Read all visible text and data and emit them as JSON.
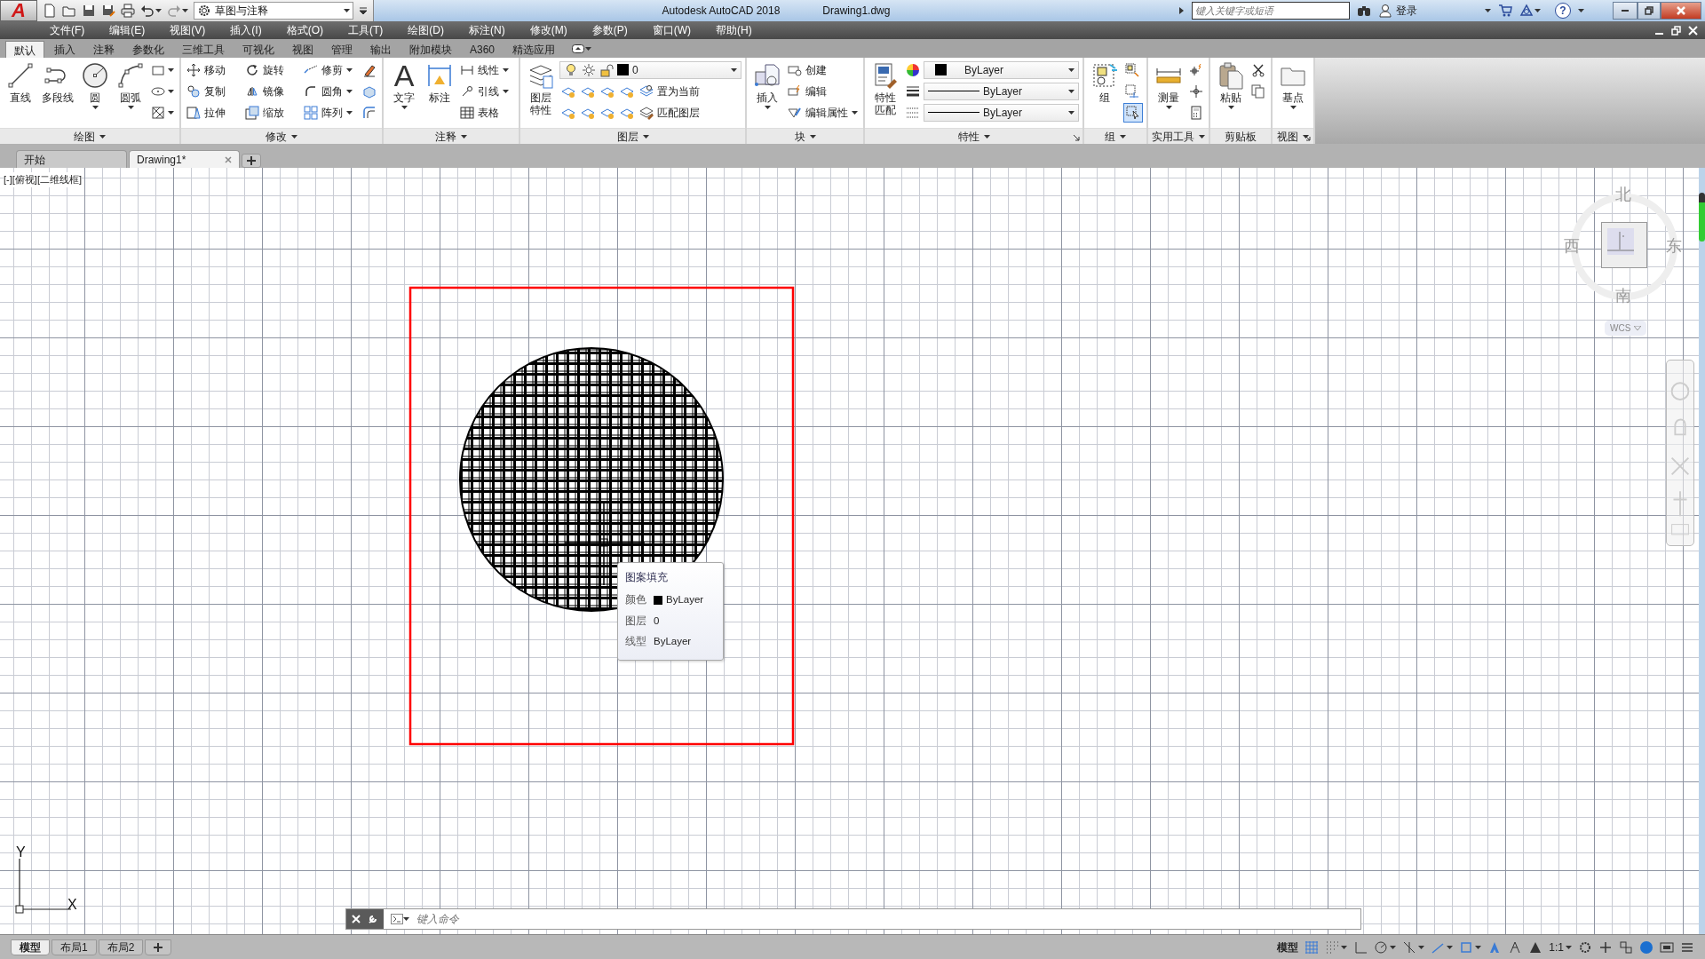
{
  "app_button": "A",
  "quick_access": {
    "workspace": "草图与注释"
  },
  "title_bar": {
    "title": "Autodesk AutoCAD 2018",
    "document": "Drawing1.dwg",
    "search": {
      "placeholder": "键入关键字或短语"
    },
    "sign_in": "登录",
    "help": "?"
  },
  "menu_bar": [
    "文件(F)",
    "编辑(E)",
    "视图(V)",
    "插入(I)",
    "格式(O)",
    "工具(T)",
    "绘图(D)",
    "标注(N)",
    "修改(M)",
    "参数(P)",
    "窗口(W)",
    "帮助(H)"
  ],
  "ribbon_tabs": [
    {
      "label": "默认",
      "selected": true
    },
    {
      "label": "插入",
      "selected": false
    },
    {
      "label": "注释",
      "selected": false
    },
    {
      "label": "参数化",
      "selected": false
    },
    {
      "label": "三维工具",
      "selected": false
    },
    {
      "label": "可视化",
      "selected": false
    },
    {
      "label": "视图",
      "selected": false
    },
    {
      "label": "管理",
      "selected": false
    },
    {
      "label": "输出",
      "selected": false
    },
    {
      "label": "附加模块",
      "selected": false
    },
    {
      "label": "A360",
      "selected": false
    },
    {
      "label": "精选应用",
      "selected": false
    }
  ],
  "ribbon_panels": [
    {
      "title": "绘图",
      "dropdown": true,
      "launcher": false,
      "large": [
        {
          "label": "直线",
          "dropdown": false
        },
        {
          "label": "多段线",
          "dropdown": false
        },
        {
          "label": "圆",
          "dropdown": true
        },
        {
          "label": "圆弧",
          "dropdown": true
        }
      ],
      "rows": [
        [
          {
            "kind": "icon",
            "dropdown": true
          }
        ],
        [
          {
            "kind": "icon",
            "dropdown": true
          }
        ],
        [
          {
            "kind": "icon",
            "dropdown": true
          }
        ]
      ]
    },
    {
      "title": "修改",
      "dropdown": true,
      "launcher": false,
      "rows": [
        [
          {
            "kind": "small",
            "label": "移动",
            "dropdown": false
          },
          {
            "kind": "small",
            "label": "旋转",
            "dropdown": false
          },
          {
            "kind": "small",
            "label": "修剪",
            "dropdown": true
          },
          {
            "kind": "icon",
            "dropdown": false
          }
        ],
        [
          {
            "kind": "small",
            "label": "复制",
            "dropdown": false
          },
          {
            "kind": "small",
            "label": "镜像",
            "dropdown": false
          },
          {
            "kind": "small",
            "label": "圆角",
            "dropdown": true
          },
          {
            "kind": "icon",
            "dropdown": false
          }
        ],
        [
          {
            "kind": "small",
            "label": "拉伸",
            "dropdown": false
          },
          {
            "kind": "small",
            "label": "缩放",
            "dropdown": false
          },
          {
            "kind": "small",
            "label": "阵列",
            "dropdown": true
          },
          {
            "kind": "icon",
            "dropdown": false
          }
        ]
      ]
    },
    {
      "title": "注释",
      "dropdown": true,
      "launcher": false,
      "large": [
        {
          "label": "文字",
          "glyph": "A",
          "dropdown": true
        },
        {
          "label": "标注",
          "dropdown": false
        }
      ],
      "rows": [
        [
          {
            "kind": "small",
            "label": "线性",
            "dropdown": true
          }
        ],
        [
          {
            "kind": "small",
            "label": "引线",
            "dropdown": true
          }
        ],
        [
          {
            "kind": "small",
            "label": "表格",
            "dropdown": false
          }
        ]
      ]
    },
    {
      "title": "图层",
      "dropdown": true,
      "launcher": false,
      "large": [
        {
          "label": "图层特性",
          "dropdown": false
        }
      ],
      "rows": [
        [
          {
            "kind": "combo",
            "value": "0"
          }
        ],
        [
          {
            "kind": "icon",
            "dropdown": false
          },
          {
            "kind": "icon",
            "dropdown": false
          },
          {
            "kind": "icon",
            "dropdown": false
          },
          {
            "kind": "icon",
            "dropdown": false
          },
          {
            "kind": "small",
            "label": "置为当前",
            "dropdown": false
          }
        ],
        [
          {
            "kind": "icon",
            "dropdown": false
          },
          {
            "kind": "icon",
            "dropdown": false
          },
          {
            "kind": "icon",
            "dropdown": false
          },
          {
            "kind": "icon",
            "dropdown": false
          },
          {
            "kind": "small",
            "label": "匹配图层",
            "dropdown": false
          }
        ]
      ]
    },
    {
      "title": "块",
      "dropdown": true,
      "launcher": false,
      "large": [
        {
          "label": "插入",
          "dropdown": true
        }
      ],
      "rows": [
        [
          {
            "kind": "small",
            "label": "创建",
            "dropdown": false
          }
        ],
        [
          {
            "kind": "small",
            "label": "编辑",
            "dropdown": false
          }
        ],
        [
          {
            "kind": "small",
            "label": "编辑属性",
            "dropdown": true
          }
        ]
      ]
    },
    {
      "title": "特性",
      "dropdown": true,
      "launcher": true,
      "large": [
        {
          "label": "特性匹配",
          "dropdown": false
        }
      ],
      "rows": [
        [
          {
            "kind": "icon",
            "dropdown": false
          },
          {
            "kind": "combo",
            "value": "ByLayer"
          }
        ],
        [
          {
            "kind": "icon",
            "dropdown": false
          },
          {
            "kind": "combo",
            "value": "ByLayer"
          }
        ],
        [
          {
            "kind": "icon",
            "dropdown": false
          },
          {
            "kind": "combo",
            "value": "ByLayer"
          }
        ]
      ]
    },
    {
      "title": "组",
      "dropdown": true,
      "launcher": false,
      "large": [
        {
          "label": "组",
          "dropdown": false
        }
      ],
      "rows": [
        [
          {
            "kind": "icon",
            "dropdown": false,
            "on": false
          }
        ],
        [
          {
            "kind": "icon",
            "dropdown": false,
            "on": false
          }
        ],
        [
          {
            "kind": "icon",
            "dropdown": false,
            "on": true
          }
        ]
      ]
    },
    {
      "title": "实用工具",
      "dropdown": true,
      "launcher": false,
      "large": [
        {
          "label": "测量",
          "dropdown": true
        }
      ],
      "rows": [
        [
          {
            "kind": "icon",
            "dropdown": false
          }
        ],
        [
          {
            "kind": "icon",
            "dropdown": false
          }
        ],
        [
          {
            "kind": "icon",
            "dropdown": false
          }
        ]
      ]
    },
    {
      "title": "剪贴板",
      "dropdown": false,
      "launcher": false,
      "large": [
        {
          "label": "粘贴",
          "dropdown": true
        }
      ],
      "rows": [
        [
          {
            "kind": "icon",
            "dropdown": false
          }
        ],
        [
          {
            "kind": "icon",
            "dropdown": false
          }
        ]
      ]
    },
    {
      "title": "视图",
      "dropdown": true,
      "launcher": true,
      "large": [
        {
          "label": "基点",
          "dropdown": true
        }
      ]
    }
  ],
  "document_tabs": [
    {
      "label": "开始",
      "selected": false,
      "closable": false
    },
    {
      "label": "Drawing1*",
      "selected": true,
      "closable": true
    }
  ],
  "viewport_label": "[-][俯视][二维线框]",
  "tooltip": {
    "title": "图案填充",
    "rows": [
      {
        "label": "颜色",
        "value": "ByLayer",
        "swatch": true
      },
      {
        "label": "图层",
        "value": "0",
        "swatch": false
      },
      {
        "label": "线型",
        "value": "ByLayer",
        "swatch": false
      }
    ]
  },
  "view_cube": {
    "north": "北",
    "south": "南",
    "west": "西",
    "east": "东",
    "ucs": "WCS"
  },
  "ucs_icon": {
    "x_label": "X",
    "y_label": "Y"
  },
  "command_line": {
    "placeholder": "键入命令"
  },
  "layout_tabs": [
    {
      "label": "模型",
      "selected": true
    },
    {
      "label": "布局1",
      "selected": false
    },
    {
      "label": "布局2",
      "selected": false
    }
  ],
  "status_bar": {
    "space": "模型",
    "scale": "1:1"
  }
}
